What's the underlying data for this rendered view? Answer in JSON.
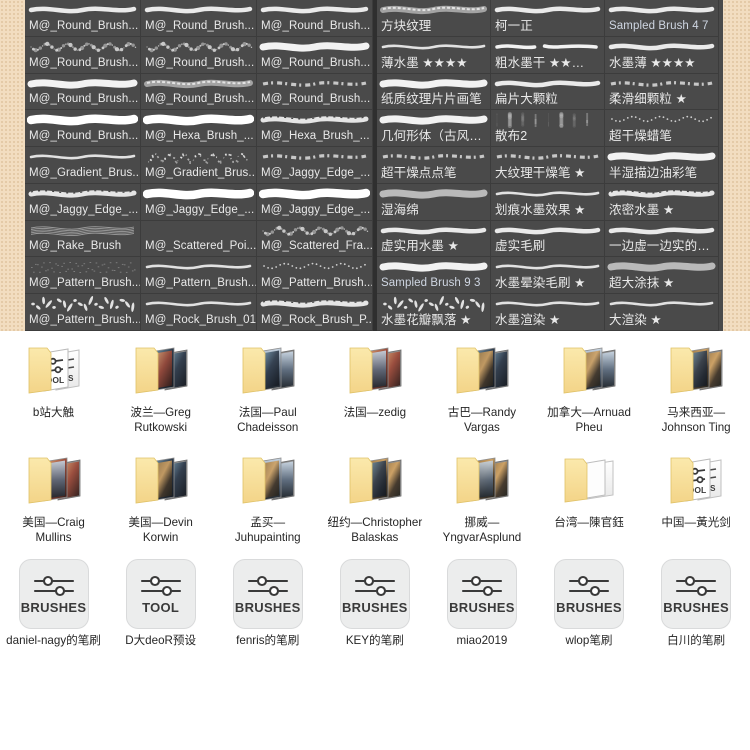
{
  "brush_panel": {
    "groups": [
      {
        "id": "group-left",
        "columns": [
          {
            "id": "col-1",
            "cells": [
              {
                "label": "M@_Round_Brush...",
                "stroke": "smooth",
                "kind": "latin"
              },
              {
                "label": "M@_Round_Brush...",
                "stroke": "speckle",
                "kind": "latin"
              },
              {
                "label": "M@_Round_Brush...",
                "stroke": "solid",
                "kind": "latin"
              },
              {
                "label": "M@_Round_Brush...",
                "stroke": "fat",
                "kind": "latin"
              },
              {
                "label": "M@_Gradient_Brus...",
                "stroke": "thin",
                "kind": "latin"
              },
              {
                "label": "M@_Jaggy_Edge_...",
                "stroke": "rough",
                "kind": "latin"
              },
              {
                "label": "M@_Rake_Brush",
                "stroke": "rake",
                "kind": "latin"
              },
              {
                "label": "M@_Pattern_Brush...",
                "stroke": "scatter",
                "kind": "latin"
              },
              {
                "label": "M@_Pattern_Brush...",
                "stroke": "blob",
                "kind": "latin"
              }
            ]
          },
          {
            "id": "col-2",
            "cells": [
              {
                "label": "M@_Round_Brush...",
                "stroke": "smooth",
                "kind": "latin"
              },
              {
                "label": "M@_Round_Brush...",
                "stroke": "speckle2",
                "kind": "latin"
              },
              {
                "label": "M@_Round_Brush...",
                "stroke": "grainy",
                "kind": "latin"
              },
              {
                "label": "M@_Hexa_Brush_...",
                "stroke": "fat",
                "kind": "latin"
              },
              {
                "label": "M@_Gradient_Brus...",
                "stroke": "flakes",
                "kind": "latin"
              },
              {
                "label": "M@_Jaggy_Edge_...",
                "stroke": "fat",
                "kind": "latin"
              },
              {
                "label": "M@_Scattered_Poi...",
                "stroke": "empty",
                "kind": "latin"
              },
              {
                "label": "M@_Pattern_Brush...",
                "stroke": "thin",
                "kind": "latin"
              },
              {
                "label": "M@_Rock_Brush_01",
                "stroke": "thin",
                "kind": "latin"
              }
            ]
          },
          {
            "id": "col-3",
            "cells": [
              {
                "label": "M@_Round_Brush...",
                "stroke": "smooth",
                "kind": "latin"
              },
              {
                "label": "M@_Round_Brush...",
                "stroke": "solid",
                "kind": "latin"
              },
              {
                "label": "M@_Round_Brush...",
                "stroke": "dry",
                "kind": "latin"
              },
              {
                "label": "M@_Hexa_Brush_...",
                "stroke": "rough",
                "kind": "latin"
              },
              {
                "label": "M@_Jaggy_Edge_...",
                "stroke": "dry",
                "kind": "latin"
              },
              {
                "label": "M@_Jaggy_Edge_...",
                "stroke": "fat",
                "kind": "latin"
              },
              {
                "label": "M@_Scattered_Fra...",
                "stroke": "speckle",
                "kind": "latin"
              },
              {
                "label": "M@_Pattern_Brush...",
                "stroke": "dots",
                "kind": "latin"
              },
              {
                "label": "M@_Rock_Brush_P...",
                "stroke": "rough",
                "kind": "latin"
              }
            ]
          }
        ]
      },
      {
        "id": "group-right",
        "columns": [
          {
            "id": "col-4",
            "cells": [
              {
                "label": "方块纹理",
                "stroke": "grainy",
                "kind": "cjk"
              },
              {
                "label": "薄水墨  ★★★★",
                "stroke": "thin",
                "kind": "cjk"
              },
              {
                "label": "纸质纹理片片画笔",
                "stroke": "solid",
                "kind": "cjk"
              },
              {
                "label": "几何形体（古风…",
                "stroke": "solid",
                "kind": "cjk"
              },
              {
                "label": "超干燥点点笔",
                "stroke": "dry",
                "kind": "cjk"
              },
              {
                "label": "湿海绵",
                "stroke": "grey",
                "kind": "cjk"
              },
              {
                "label": "虚实用水墨  ★",
                "stroke": "smooth",
                "kind": "cjk"
              },
              {
                "label": "Sampled Brush 9 3",
                "stroke": "solid",
                "kind": "sampled"
              },
              {
                "label": "水墨花瓣飘落 ★",
                "stroke": "blob",
                "kind": "cjk"
              }
            ]
          },
          {
            "id": "col-5",
            "cells": [
              {
                "label": "柯一正",
                "stroke": "smooth",
                "kind": "cjk"
              },
              {
                "label": "粗水墨干  ★★…",
                "stroke": "broken",
                "kind": "cjk"
              },
              {
                "label": "扁片大颗粒",
                "stroke": "smooth",
                "kind": "cjk"
              },
              {
                "label": "散布2",
                "stroke": "cloud",
                "kind": "cjk"
              },
              {
                "label": "大纹理干燥笔  ★",
                "stroke": "dry",
                "kind": "cjk"
              },
              {
                "label": "划痕水墨效果 ★",
                "stroke": "thin",
                "kind": "cjk"
              },
              {
                "label": "虚实毛刷",
                "stroke": "smooth",
                "kind": "cjk"
              },
              {
                "label": "水墨晕染毛刷 ★",
                "stroke": "thin",
                "kind": "cjk"
              },
              {
                "label": "水墨渲染 ★",
                "stroke": "thin",
                "kind": "cjk"
              }
            ]
          },
          {
            "id": "col-6",
            "cells": [
              {
                "label": "Sampled Brush 4 7",
                "stroke": "smooth",
                "kind": "sampled"
              },
              {
                "label": "水墨薄  ★★★★",
                "stroke": "smooth",
                "kind": "cjk"
              },
              {
                "label": "柔滑细颗粒 ★",
                "stroke": "dry",
                "kind": "cjk"
              },
              {
                "label": "超干燥蜡笔",
                "stroke": "dots",
                "kind": "cjk"
              },
              {
                "label": "半湿描边油彩笔",
                "stroke": "solid",
                "kind": "cjk"
              },
              {
                "label": "浓密水墨  ★",
                "stroke": "rough",
                "kind": "cjk"
              },
              {
                "label": "一边虚一边实的…",
                "stroke": "smooth",
                "kind": "cjk"
              },
              {
                "label": "超大涂抹 ★",
                "stroke": "grey",
                "kind": "cjk"
              },
              {
                "label": "大渲染 ★",
                "stroke": "thin",
                "kind": "cjk"
              }
            ]
          }
        ]
      }
    ]
  },
  "files": {
    "row1": [
      {
        "name": "b站大触",
        "icon": "folder-brushes-tool"
      },
      {
        "name": "波兰—Greg Rutkowski",
        "icon": "folder-artwork"
      },
      {
        "name": "法国—Paul Chadeisson",
        "icon": "folder-artwork"
      },
      {
        "name": "法国—zedig",
        "icon": "folder-artwork"
      },
      {
        "name": "古巴—Randy Vargas",
        "icon": "folder-artwork"
      },
      {
        "name": "加拿大—Arnuad Pheu",
        "icon": "folder-artwork"
      },
      {
        "name": "马来西亚—Johnson Ting",
        "icon": "folder-artwork"
      }
    ],
    "row2": [
      {
        "name": "美国—Craig Mullins",
        "icon": "folder-artwork"
      },
      {
        "name": "美国—Devin Korwin",
        "icon": "folder-artwork"
      },
      {
        "name": "孟买—Juhupainting",
        "icon": "folder-artwork"
      },
      {
        "name": "纽约—Christopher Balaskas",
        "icon": "folder-artwork"
      },
      {
        "name": "挪威—YngvarAsplund",
        "icon": "folder-artwork"
      },
      {
        "name": "台湾—陳官鈺",
        "icon": "folder-plain"
      },
      {
        "name": "中国—黃光剑",
        "icon": "folder-brushes-tool"
      }
    ],
    "row3": [
      {
        "name": "daniel-nagy的笔刷",
        "icon": "brushes-tile",
        "tile_word": "BRUSHES"
      },
      {
        "name": "D大deoR预设",
        "icon": "brushes-tile",
        "tile_word": "TOOL"
      },
      {
        "name": "fenris的笔刷",
        "icon": "brushes-tile",
        "tile_word": "BRUSHES"
      },
      {
        "name": "KEY的笔刷",
        "icon": "brushes-tile",
        "tile_word": "BRUSHES"
      },
      {
        "name": "miao2019",
        "icon": "brushes-tile",
        "tile_word": "BRUSHES"
      },
      {
        "name": "wlop笔刷",
        "icon": "brushes-tile",
        "tile_word": "BRUSHES"
      },
      {
        "name": "白川的笔刷",
        "icon": "brushes-tile",
        "tile_word": "BRUSHES"
      }
    ]
  },
  "colors": {
    "panel_bg": "#4a4a4a",
    "panel_border": "#3c3c3c",
    "desk_bg": "#f2ddc0",
    "label_text": "#e9e9e9",
    "sampled_text": "#cfd6e2",
    "folder_yellow": "#f7dd8f",
    "tile_bg": "#eceded"
  }
}
